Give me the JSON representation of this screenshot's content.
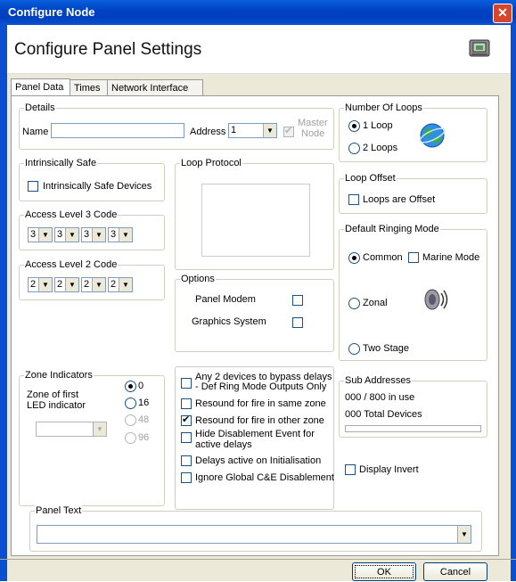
{
  "window": {
    "title": "Configure Node",
    "close_glyph": "✕"
  },
  "header": {
    "title": "Configure Panel Settings"
  },
  "tabs": [
    {
      "label": "Panel Data"
    },
    {
      "label": "Times"
    },
    {
      "label": "Network Interface"
    }
  ],
  "details": {
    "legend": "Details",
    "name_label": "Name",
    "name_value": "",
    "address_label": "Address",
    "address_value": "1",
    "master_label_1": "Master",
    "master_label_2": "Node",
    "master_checked": true
  },
  "intrinsically_safe": {
    "legend": "Intrinsically Safe",
    "checkbox_label": "Intrinsically Safe Devices",
    "checked": false
  },
  "access3": {
    "legend": "Access Level 3 Code",
    "values": [
      "3",
      "3",
      "3",
      "3"
    ]
  },
  "access2": {
    "legend": "Access Level 2 Code",
    "values": [
      "2",
      "2",
      "2",
      "2"
    ]
  },
  "loop_protocol": {
    "legend": "Loop Protocol"
  },
  "options": {
    "legend": "Options",
    "panel_modem": "Panel Modem",
    "graphics_system": "Graphics System"
  },
  "number_of_loops": {
    "legend": "Number Of Loops",
    "opt1": "1 Loop",
    "opt2": "2 Loops",
    "selected": "1 Loop"
  },
  "loop_offset": {
    "legend": "Loop Offset",
    "checkbox_label": "Loops are Offset"
  },
  "ringing": {
    "legend": "Default Ringing Mode",
    "common": "Common",
    "marine": "Marine Mode",
    "zonal": "Zonal",
    "two_stage": "Two Stage",
    "selected": "Common"
  },
  "zone_indicators": {
    "legend": "Zone Indicators",
    "label_1": "Zone of first",
    "label_2": "LED indicator",
    "opt0": "0",
    "opt16": "16",
    "opt48": "48",
    "opt96": "96",
    "selected": "0"
  },
  "delays": {
    "item1_line1": "Any 2 devices to bypass delays",
    "item1_line2": "- Def Ring Mode Outputs Only",
    "item2": "Resound for fire in same zone",
    "item3": "Resound for fire in other zone",
    "item4_line1": "Hide Disablement Event for",
    "item4_line2": "active delays",
    "item5": "Delays active on Initialisation",
    "item6": "Ignore Global C&E Disablement",
    "item3_checked": true
  },
  "sub_addresses": {
    "legend": "Sub Addresses",
    "in_use": "000 / 800   in use",
    "total": "000 Total Devices"
  },
  "display_invert": {
    "label": "Display Invert"
  },
  "panel_text": {
    "legend": "Panel Text",
    "value": ""
  },
  "buttons": {
    "ok": "OK",
    "cancel": "Cancel"
  },
  "colors": {
    "titlebar": "#0043c5",
    "close": "#d8452c",
    "dialog": "#ece9d8"
  }
}
